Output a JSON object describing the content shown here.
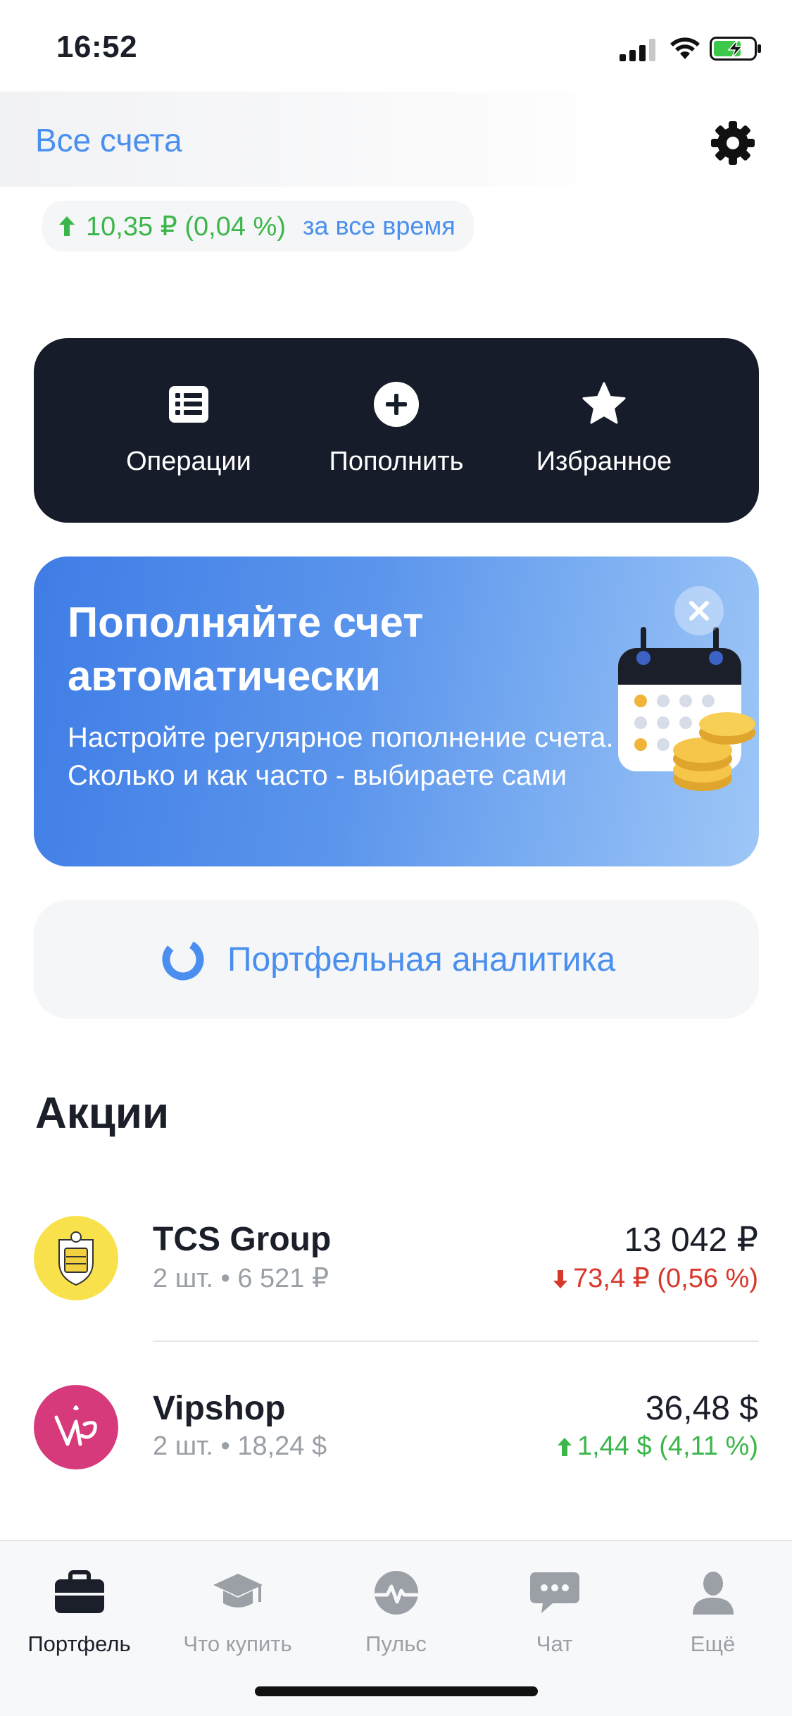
{
  "status_bar": {
    "time": "16:52"
  },
  "header": {
    "all_accounts": "Все счета",
    "settings_icon": "gear-icon"
  },
  "profit": {
    "arrow_icon": "arrow-up-icon",
    "value": "10,35 ₽ (0,04 %)",
    "period": "за все время"
  },
  "actions": [
    {
      "label": "Операции",
      "icon": "list-icon"
    },
    {
      "label": "Пополнить",
      "icon": "plus-circle-icon"
    },
    {
      "label": "Избранное",
      "icon": "star-icon"
    }
  ],
  "promo": {
    "title": "Пополняйте счет автоматически",
    "text": "Настройте регулярное пополнение счета. Сколько и как часто - выбираете сами",
    "close_icon": "close-icon",
    "illustration": "calendar-coins-icon"
  },
  "analytics": {
    "label": "Портфельная аналитика",
    "icon": "donut-chart-icon"
  },
  "stocks": {
    "title": "Акции",
    "items": [
      {
        "name": "TCS Group",
        "sub": "2 шт. • 6 521 ₽",
        "price": "13 042 ₽",
        "change": "73,4 ₽ (0,56 %)",
        "direction": "down",
        "color": "#d8372c"
      },
      {
        "name": "Vipshop",
        "sub": "2 шт. • 18,24 $",
        "price": "36,48 $",
        "change": "1,44 $ (4,11 %)",
        "direction": "up",
        "color": "#3cb64a"
      }
    ]
  },
  "tabbar": [
    {
      "label": "Портфель",
      "icon": "briefcase-icon",
      "active": true
    },
    {
      "label": "Что купить",
      "icon": "graduation-cap-icon",
      "active": false
    },
    {
      "label": "Пульс",
      "icon": "pulse-icon",
      "active": false
    },
    {
      "label": "Чат",
      "icon": "chat-icon",
      "active": false
    },
    {
      "label": "Ещё",
      "icon": "person-icon",
      "active": false
    }
  ],
  "colors": {
    "accent": "#4a8ff0",
    "positive": "#3cb64a",
    "negative": "#d8372c",
    "dark_card": "#171c2a"
  }
}
